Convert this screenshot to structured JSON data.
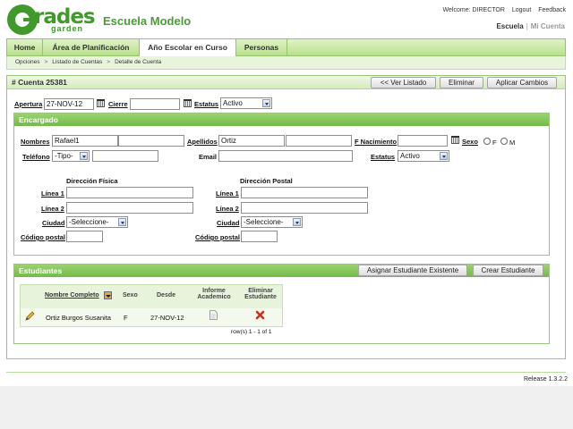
{
  "logo": {
    "rades": "rades",
    "garden": "garden"
  },
  "school_name": "Escuela Modelo",
  "top_links": {
    "welcome": "Welcome: DIRECTOR",
    "logout": "Logout",
    "feedback": "Feedback",
    "escuela": "Escuela",
    "separator": "|",
    "mi_cuenta": "Mi Cuenta"
  },
  "nav": {
    "tabs": [
      "Home",
      "Área de Planificación",
      "Año Escolar en Curso",
      "Personas"
    ],
    "active_index": 2
  },
  "breadcrumb": {
    "items": [
      "Opciones",
      "Listado de Cuentas",
      "Detalle de Cuenta"
    ],
    "separator": ">"
  },
  "account": {
    "title": "# Cuenta 25381",
    "buttons": {
      "list": "<< Ver Listado",
      "delete": "Eliminar",
      "apply": "Aplicar Cambios"
    },
    "apertura_label": "Apertura",
    "apertura_value": "27-NOV-12",
    "cierre_label": "Cierre",
    "cierre_value": "",
    "estatus_label": "Estatus",
    "estatus_value": "Activo"
  },
  "encargado": {
    "title": "Encargado",
    "nombres_label": "Nombres",
    "nombre1": "Rafael1",
    "nombre2": "",
    "apellidos_label": "Apellidos",
    "apellido1": "Ortiz",
    "apellido2": "",
    "fnac_label": "F Nacimiento",
    "fnac_value": "",
    "sexo_label": "Sexo",
    "sexo_f": "F",
    "sexo_m": "M",
    "telefono_label": "Teléfono",
    "telefono_tipo": "-Tipo-",
    "telefono_value": "",
    "email_label": "Email",
    "email_value": "",
    "estatus_label": "Estatus",
    "estatus_value": "Activo",
    "fisica_title": "Dirección Física",
    "postal_title": "Dirección Postal",
    "linea1_label": "Línea 1",
    "linea2_label": "Línea 2",
    "ciudad_label": "Ciudad",
    "ciudad_value": "-Seleccione-",
    "codigo_label": "Código postal"
  },
  "estudiantes": {
    "title": "Estudiantes",
    "btn_asignar": "Asignar Estudiante Existente",
    "btn_crear": "Crear Estudiante",
    "columns": {
      "nombre": "Nombre Completo",
      "sexo": "Sexo",
      "desde": "Desde",
      "informe1": "Informe",
      "informe2": "Academico",
      "eliminar1": "Eliminar",
      "eliminar2": "Estudiante"
    },
    "rows": [
      {
        "nombre": "Ortiz Burgos Susanita",
        "sexo": "F",
        "desde": "27-NOV-12"
      }
    ],
    "pagination": "row(s) 1 - 1 of 1"
  },
  "release": "Release 1.3.2.2",
  "colors": {
    "brand_green": "#3f9a2b",
    "panel_green": "#74b94a",
    "delete_red": "#d22b1e"
  }
}
